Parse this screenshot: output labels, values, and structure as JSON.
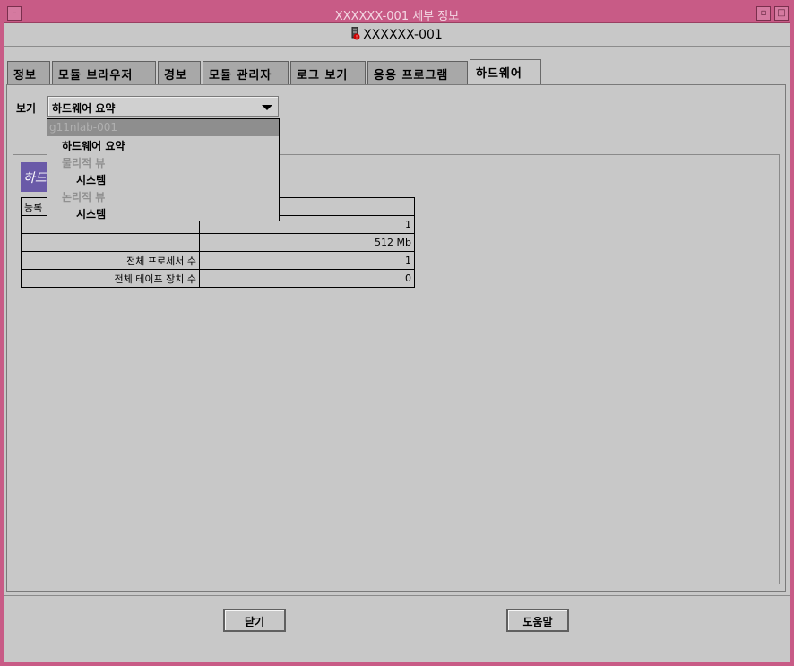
{
  "window": {
    "title": "XXXXXX-001 세부 정보"
  },
  "header": {
    "host_name": "XXXXXX-001",
    "icon": "server-alarm-icon"
  },
  "tabs": [
    {
      "label": "정보"
    },
    {
      "label": "모듈 브라우저"
    },
    {
      "label": "경보"
    },
    {
      "label": "모듈 관리자"
    },
    {
      "label": "로그 보기"
    },
    {
      "label": "응용 프로그램"
    },
    {
      "label": "하드웨어",
      "active": true
    }
  ],
  "view": {
    "label": "보기",
    "selected": "하드웨어 요약"
  },
  "dropdown": {
    "items": [
      {
        "text": "g11nlab-001"
      },
      {
        "text": "하드웨어 요약"
      },
      {
        "text": "물리적 뷰"
      },
      {
        "text": "시스템"
      },
      {
        "text": "논리적 뷰"
      },
      {
        "text": "시스템"
      }
    ]
  },
  "summary": {
    "title": "하드",
    "table_header": "등록",
    "rows": [
      {
        "label": "",
        "value": "1"
      },
      {
        "label": "",
        "value": "512 Mb"
      },
      {
        "label": "전체 프로세서 수",
        "value": "1"
      },
      {
        "label": "전체 테이프 장치 수",
        "value": "0"
      }
    ]
  },
  "buttons": {
    "close": "닫기",
    "help": "도움말"
  },
  "colors": {
    "titlebar": "#c85b86",
    "background": "#c8c8c8",
    "summary_title": "#6a5aa8"
  }
}
